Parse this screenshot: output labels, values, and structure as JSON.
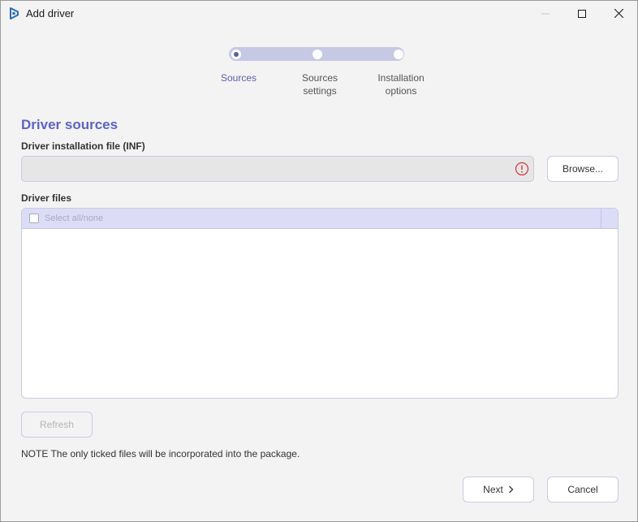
{
  "window": {
    "title": "Add driver",
    "controls": {
      "minimize": "minimize-icon",
      "maximize": "maximize-icon",
      "close": "close-icon"
    }
  },
  "stepper": {
    "steps": [
      {
        "line1": "Sources",
        "line2": "",
        "active": true
      },
      {
        "line1": "Sources",
        "line2": "settings",
        "active": false
      },
      {
        "line1": "Installation",
        "line2": "options",
        "active": false
      }
    ]
  },
  "sources": {
    "heading": "Driver sources",
    "inf_label": "Driver installation file (INF)",
    "inf_value": "",
    "browse_label": "Browse...",
    "files_label": "Driver files",
    "select_all_label": "Select all/none",
    "refresh_label": "Refresh",
    "note": "NOTE The only ticked files will be incorporated into the package."
  },
  "footer": {
    "next_label": "Next",
    "cancel_label": "Cancel"
  },
  "colors": {
    "accent": "#5c63c4",
    "stepper_track": "#c6c9e4",
    "table_header": "#dcdcf6",
    "error": "#d13438"
  }
}
